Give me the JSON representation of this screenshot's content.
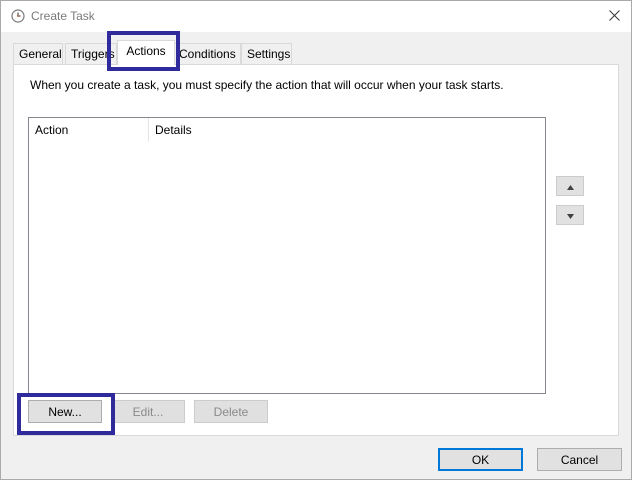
{
  "window": {
    "title": "Create Task",
    "icon": "clock-icon",
    "close_icon": "close-icon"
  },
  "tabs": [
    {
      "label": "General",
      "active": false
    },
    {
      "label": "Triggers",
      "active": false
    },
    {
      "label": "Actions",
      "active": true
    },
    {
      "label": "Conditions",
      "active": false
    },
    {
      "label": "Settings",
      "active": false
    }
  ],
  "actions_tab": {
    "description": "When you create a task, you must specify the action that will occur when your task starts.",
    "columns": [
      "Action",
      "Details"
    ],
    "rows": [],
    "move_up_icon": "arrow-up-icon",
    "move_down_icon": "arrow-down-icon",
    "new_label": "New...",
    "edit_label": "Edit...",
    "delete_label": "Delete"
  },
  "footer": {
    "ok_label": "OK",
    "cancel_label": "Cancel"
  },
  "colors": {
    "highlight": "#2f2b9c",
    "default_button_border": "#0078d7"
  }
}
